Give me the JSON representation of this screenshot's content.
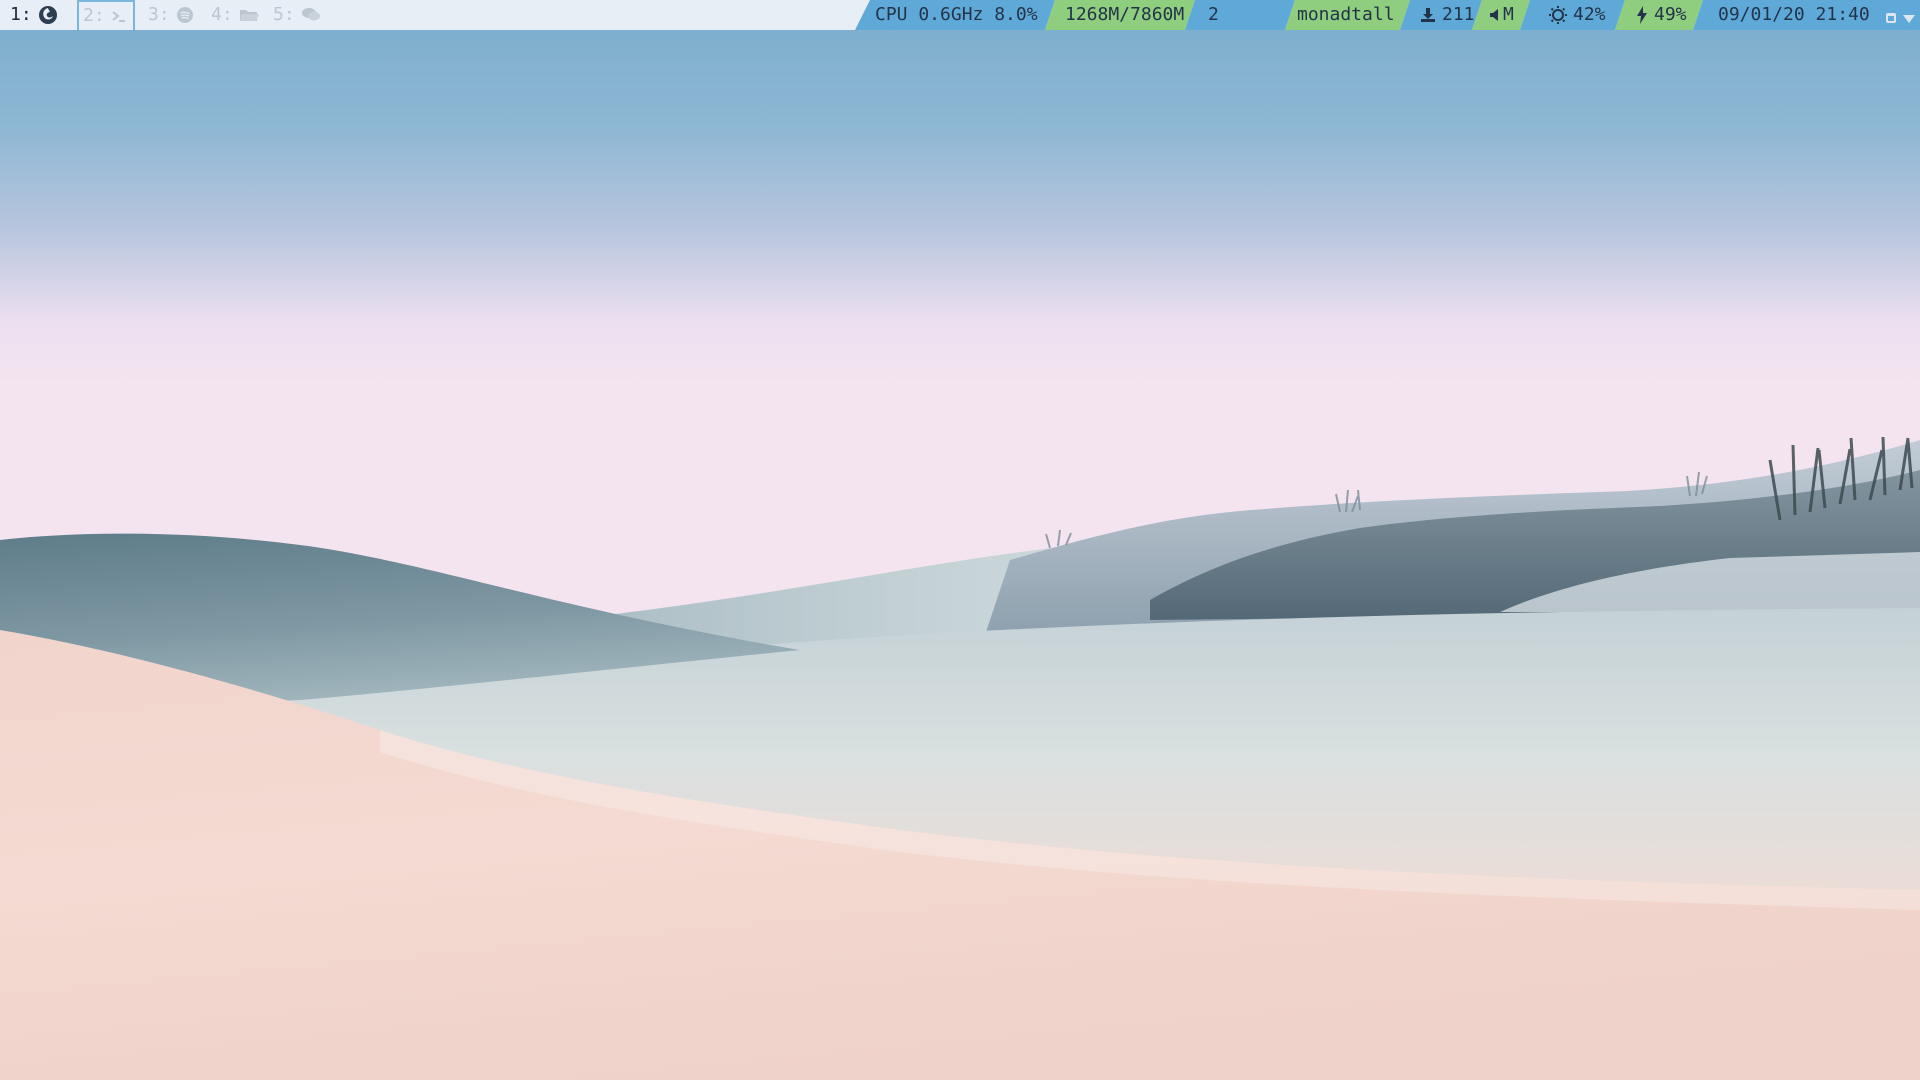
{
  "workspaces": [
    {
      "label": "1:",
      "icon": "firefox-icon",
      "state": "active"
    },
    {
      "label": "2:",
      "icon": "terminal-icon",
      "state": "focused"
    },
    {
      "label": "3:",
      "icon": "spotify-icon",
      "state": "empty"
    },
    {
      "label": "4:",
      "icon": "folder-icon",
      "state": "empty"
    },
    {
      "label": "5:",
      "icon": "chat-icon",
      "state": "empty"
    }
  ],
  "bar": {
    "cpu": "CPU 0.6GHz 8.0%",
    "memory": "1268M/7860M",
    "window_count": "2",
    "layout": "monadtall",
    "updates": "211",
    "volume": "M",
    "brightness": "42%",
    "battery": "49%",
    "clock": "09/01/20 21:40"
  },
  "colors": {
    "bar_background": "#e7eef5",
    "segment_blue": "#5fa9d8",
    "segment_green": "#8fce7e",
    "focus_border": "#7ab7dd",
    "text_dark": "#23344a"
  }
}
